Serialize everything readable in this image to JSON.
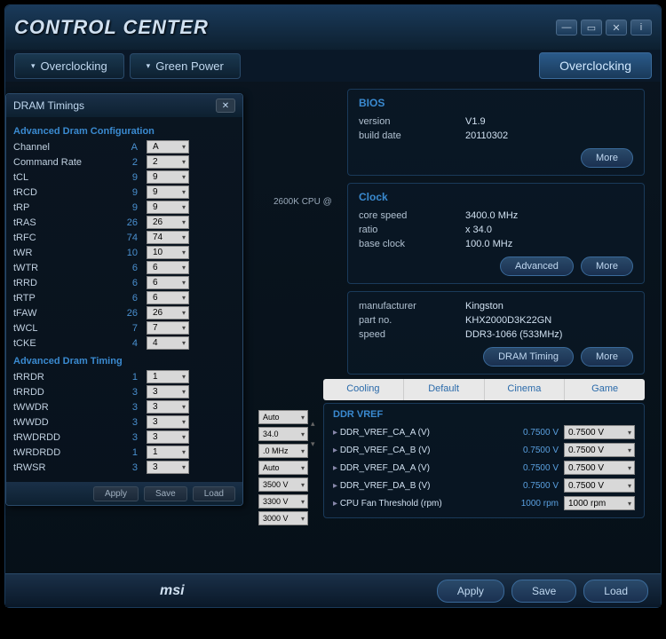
{
  "app_title": "CONTROL CENTER",
  "tabs": {
    "overclocking": "Overclocking",
    "greenpower": "Green Power",
    "active": "Overclocking"
  },
  "bios": {
    "title": "BIOS",
    "version_k": "version",
    "version_v": "V1.9",
    "build_k": "build date",
    "build_v": "20110302",
    "more": "More"
  },
  "clock": {
    "title": "Clock",
    "core_k": "core speed",
    "core_v": "3400.0 MHz",
    "ratio_k": "ratio",
    "ratio_v": "x 34.0",
    "base_k": "base clock",
    "base_v": "100.0 MHz",
    "adv": "Advanced",
    "more": "More"
  },
  "mem": {
    "mfr_k": "manufacturer",
    "mfr_v": "Kingston",
    "pn_k": "part no.",
    "pn_v": "KHX2000D3K22GN",
    "spd_k": "speed",
    "spd_v": "DDR3-1066 (533MHz)",
    "dram": "DRAM Timing",
    "more": "More"
  },
  "cpu_hint": "2600K CPU @",
  "profiles": [
    "Cooling",
    "Default",
    "Cinema",
    "Game"
  ],
  "vref": {
    "title": "DDR VREF",
    "rows": [
      {
        "l": "DDR_VREF_CA_A (V)",
        "v": "0.7500 V",
        "s": "0.7500 V"
      },
      {
        "l": "DDR_VREF_CA_B (V)",
        "v": "0.7500 V",
        "s": "0.7500 V"
      },
      {
        "l": "DDR_VREF_DA_A (V)",
        "v": "0.7500 V",
        "s": "0.7500 V"
      },
      {
        "l": "DDR_VREF_DA_B (V)",
        "v": "0.7500 V",
        "s": "0.7500 V"
      },
      {
        "l": "CPU Fan Threshold (rpm)",
        "v": "1000 rpm",
        "s": "1000 rpm"
      }
    ]
  },
  "bg_sels": [
    "Auto",
    "34.0",
    ".0 MHz",
    "Auto",
    "3500 V",
    "3300 V",
    "3000 V"
  ],
  "actions": {
    "apply": "Apply",
    "save": "Save",
    "load": "Load"
  },
  "msi": "msi",
  "popup": {
    "title": "DRAM Timings",
    "sect1": "Advanced Dram Configuration",
    "sect2": "Advanced Dram Timing",
    "rows1": [
      {
        "n": "Channel",
        "c": "A",
        "s": "A"
      },
      {
        "n": "Command Rate",
        "c": "2",
        "s": "2"
      },
      {
        "n": "tCL",
        "c": "9",
        "s": "9"
      },
      {
        "n": "tRCD",
        "c": "9",
        "s": "9"
      },
      {
        "n": "tRP",
        "c": "9",
        "s": "9"
      },
      {
        "n": "tRAS",
        "c": "26",
        "s": "26"
      },
      {
        "n": "tRFC",
        "c": "74",
        "s": "74"
      },
      {
        "n": "tWR",
        "c": "10",
        "s": "10"
      },
      {
        "n": "tWTR",
        "c": "6",
        "s": "6"
      },
      {
        "n": "tRRD",
        "c": "6",
        "s": "6"
      },
      {
        "n": "tRTP",
        "c": "6",
        "s": "6"
      },
      {
        "n": "tFAW",
        "c": "26",
        "s": "26"
      },
      {
        "n": "tWCL",
        "c": "7",
        "s": "7"
      },
      {
        "n": "tCKE",
        "c": "4",
        "s": "4"
      }
    ],
    "rows2": [
      {
        "n": "tRRDR",
        "c": "1",
        "s": "1"
      },
      {
        "n": "tRRDD",
        "c": "3",
        "s": "3"
      },
      {
        "n": "tWWDR",
        "c": "3",
        "s": "3"
      },
      {
        "n": "tWWDD",
        "c": "3",
        "s": "3"
      },
      {
        "n": "tRWDRDD",
        "c": "3",
        "s": "3"
      },
      {
        "n": "tWRDRDD",
        "c": "1",
        "s": "1"
      },
      {
        "n": "tRWSR",
        "c": "3",
        "s": "3"
      }
    ],
    "apply": "Apply",
    "save": "Save",
    "load": "Load"
  }
}
